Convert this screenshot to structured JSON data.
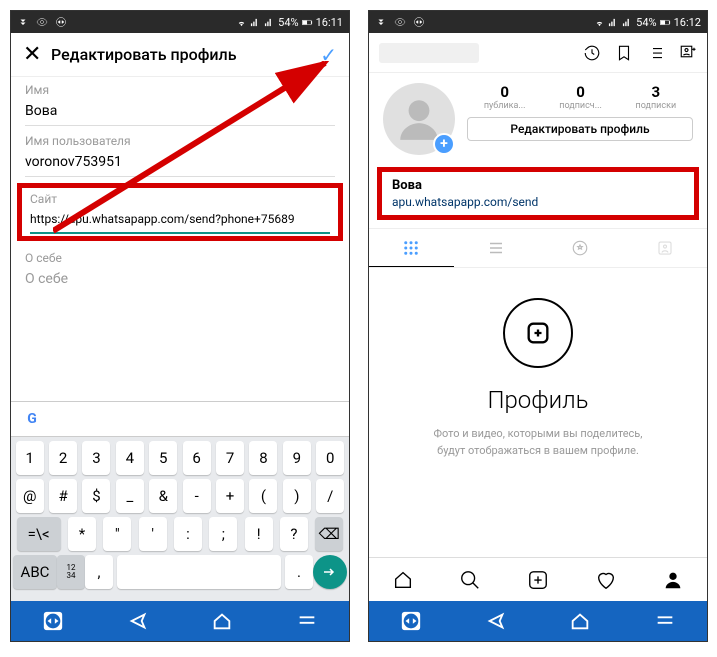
{
  "status": {
    "battery": "54%",
    "time_left": "16:11",
    "time_right": "16:12"
  },
  "left": {
    "header_title": "Редактировать профиль",
    "name_label": "Имя",
    "name_value": "Вова",
    "username_label": "Имя пользователя",
    "username_value": "voronov753951",
    "site_label": "Сайт",
    "site_value": "https://apu.whatsapapp.com/send?phone+75689",
    "about_label": "О себе",
    "about_value": "О себе",
    "keyboard": {
      "row1": [
        "1",
        "2",
        "3",
        "4",
        "5",
        "6",
        "7",
        "8",
        "9",
        "0"
      ],
      "row2": [
        "@",
        "#",
        "$",
        "_",
        "&",
        "-",
        "+",
        "(",
        ")",
        "/"
      ],
      "row3": [
        "=\\<",
        "*",
        "\"",
        "'",
        ":",
        ";",
        "!",
        "?",
        "⌫"
      ],
      "row4_abc": "ABC",
      "row4_lang": "₁ ₁₂\n₃ ₃₄",
      "row4_comma": ",",
      "row4_dot": "."
    }
  },
  "right": {
    "stats": {
      "posts_num": "0",
      "posts_lbl": "публика...",
      "followers_num": "0",
      "followers_lbl": "подписч...",
      "following_num": "3",
      "following_lbl": "подписки"
    },
    "edit_button": "Редактировать профиль",
    "bio_name": "Вова",
    "bio_link": "apu.whatsapapp.com/send",
    "empty_title": "Профиль",
    "empty_text1": "Фото и видео, которыми вы поделитесь,",
    "empty_text2": "будут отображаться в вашем профиле."
  }
}
